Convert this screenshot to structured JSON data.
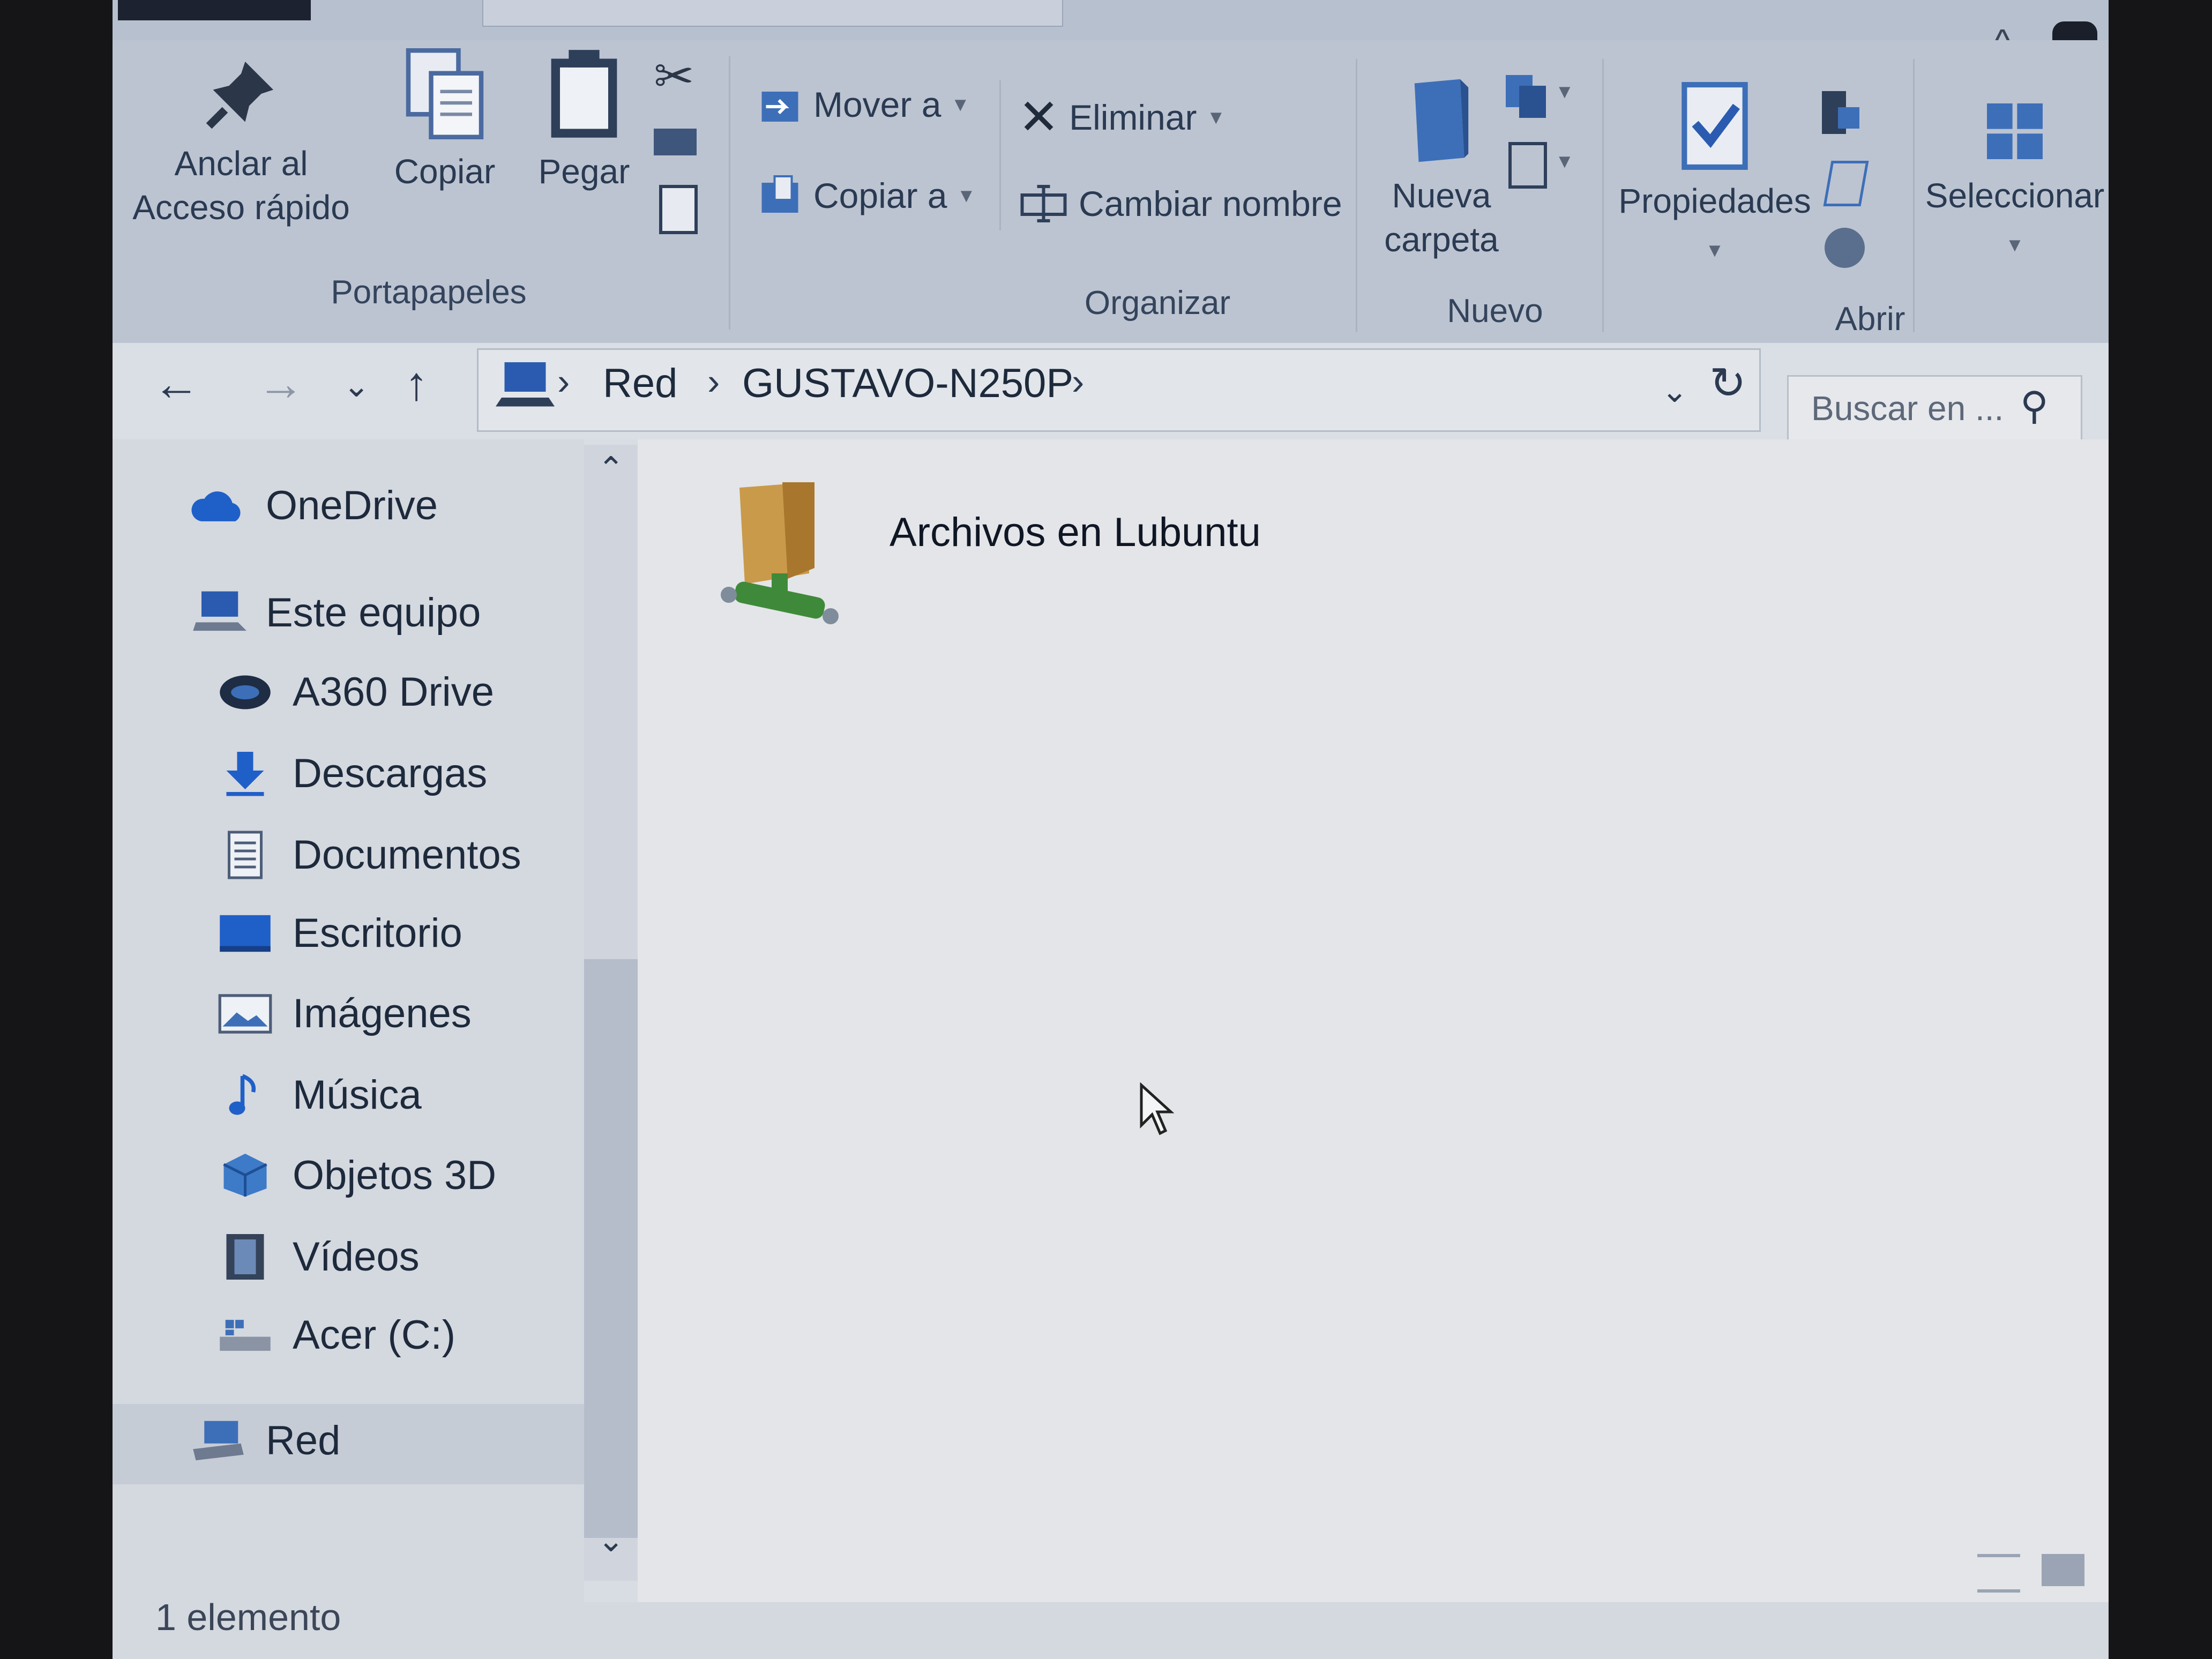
{
  "ribbon": {
    "portapapeles": {
      "pin_line1": "Anclar al",
      "pin_line2": "Acceso rápido",
      "copy": "Copiar",
      "paste": "Pegar",
      "group": "Portapapeles"
    },
    "organizar": {
      "move_to": "Mover a",
      "copy_to": "Copiar a",
      "delete": "Eliminar",
      "rename": "Cambiar nombre",
      "group": "Organizar"
    },
    "nuevo": {
      "new_folder_line1": "Nueva",
      "new_folder_line2": "carpeta",
      "group": "Nuevo"
    },
    "abrir": {
      "properties": "Propiedades",
      "group": "Abrir"
    },
    "select": "Seleccionar"
  },
  "address": {
    "breadcrumbs": [
      "Red",
      "GUSTAVO-N250P"
    ],
    "search_placeholder": "Buscar en ..."
  },
  "sidebar": {
    "items": [
      {
        "label": "OneDrive",
        "icon": "cloud-icon"
      },
      {
        "label": "Este equipo",
        "icon": "computer-icon"
      },
      {
        "label": "A360 Drive",
        "icon": "a360-drive-icon"
      },
      {
        "label": "Descargas",
        "icon": "download-arrow-icon"
      },
      {
        "label": "Documentos",
        "icon": "document-icon"
      },
      {
        "label": "Escritorio",
        "icon": "desktop-icon"
      },
      {
        "label": "Imágenes",
        "icon": "pictures-icon"
      },
      {
        "label": "Música",
        "icon": "music-note-icon"
      },
      {
        "label": "Objetos 3D",
        "icon": "cube-3d-icon"
      },
      {
        "label": "Vídeos",
        "icon": "film-icon"
      },
      {
        "label": "Acer (C:)",
        "icon": "drive-icon"
      },
      {
        "label": "Red",
        "icon": "network-icon"
      }
    ]
  },
  "content": {
    "items": [
      {
        "label": "Archivos en Lubuntu",
        "icon": "shared-folder-icon"
      }
    ]
  },
  "status": {
    "count": "1 elemento"
  },
  "colors": {
    "accent_blue": "#1f6fd6",
    "ribbon_bg": "#bcc4d1",
    "content_bg": "#e3e5e8"
  }
}
